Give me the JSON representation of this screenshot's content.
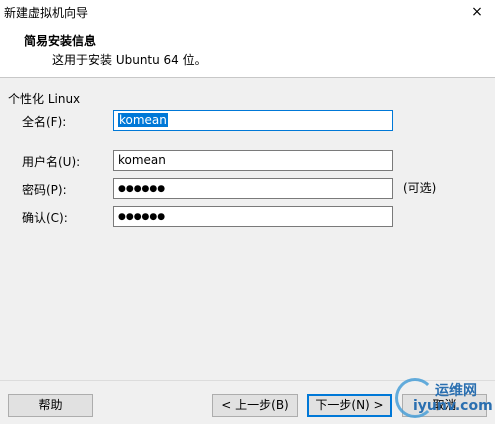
{
  "window": {
    "title": "新建虚拟机向导",
    "close_glyph": "×"
  },
  "header": {
    "title": "简易安装信息",
    "subtitle": "这用于安装 Ubuntu 64 位。"
  },
  "form": {
    "section_label": "个性化 Linux",
    "fullname_label": "全名(F):",
    "fullname_value": "komean",
    "username_label": "用户名(U):",
    "username_value": "komean",
    "password_label": "密码(P):",
    "password_masked": "●●●●●●",
    "password_note": "(可选)",
    "confirm_label": "确认(C):",
    "confirm_masked": "●●●●●●"
  },
  "buttons": {
    "help": "帮助",
    "back": "< 上一步(B)",
    "next": "下一步(N) >",
    "cancel": "取消"
  },
  "watermark": {
    "cn": "运维网",
    "en": "iyunv.com",
    "color": "#2a6fb0"
  },
  "colors": {
    "selection": "#0078d7",
    "background": "#f0f0f0"
  }
}
